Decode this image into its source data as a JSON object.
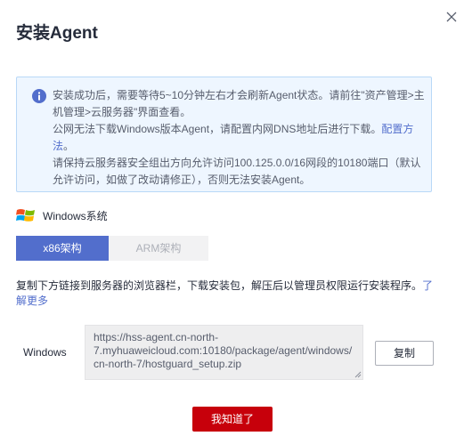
{
  "dialog": {
    "title": "安装Agent",
    "close_icon": "close-icon"
  },
  "notice": {
    "icon": "info-icon",
    "accent": "#526ecc",
    "line1": "安装成功后，需要等待5~10分钟左右才会刷新Agent状态。请前往\"资产管理>主机管理>云服务器\"界面查看。",
    "line2_prefix": "公网无法下载Windows版本Agent，请配置内网DNS地址后进行下载。",
    "line2_link": "配置方法",
    "line2_suffix": "。",
    "line3": "请保持云服务器安全组出方向允许访问100.125.0.0/16网段的10180端口（默认允许访问，如做了改动请修正），否则无法安装Agent。"
  },
  "os": {
    "icon": "windows-icon",
    "label": "Windows系统"
  },
  "tabs": [
    {
      "label": "x86架构",
      "active": true
    },
    {
      "label": "ARM架构",
      "active": false
    }
  ],
  "description": {
    "text": "复制下方链接到服务器的浏览器栏，下载安装包，解压后以管理员权限运行安装程序。",
    "link": "了解更多"
  },
  "download": {
    "label": "Windows",
    "url": "https://hss-agent.cn-north-7.myhuaweicloud.com:10180/package/agent/windows/cn-north-7/hostguard_setup.zip",
    "copy_label": "复制"
  },
  "footer": {
    "ok_label": "我知道了",
    "ok_color": "#c7000b"
  }
}
